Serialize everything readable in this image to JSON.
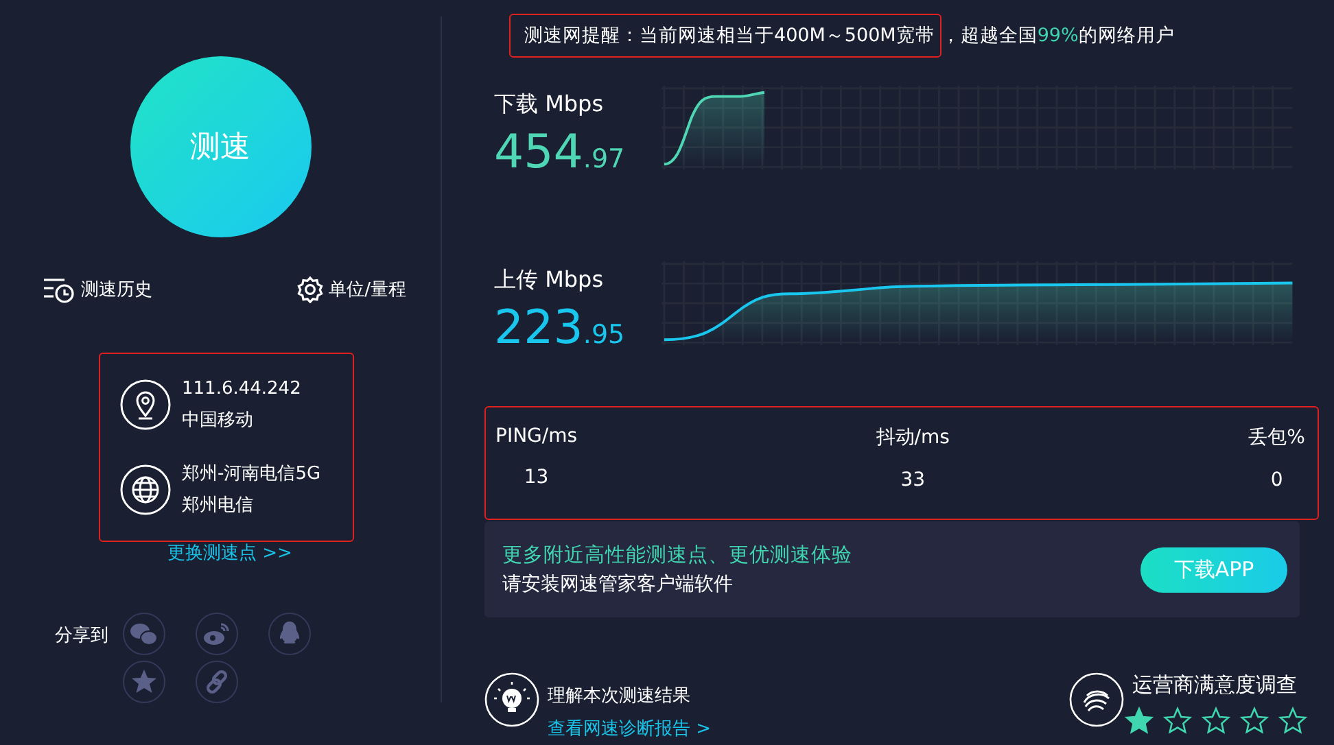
{
  "test_button": {
    "label": "测速"
  },
  "tools": [
    {
      "kind": "history",
      "label": "测速历史"
    },
    {
      "kind": "settings",
      "label": "单位/量程"
    }
  ],
  "connection": {
    "highlighted": true,
    "items": [
      {
        "kind": "location",
        "primary": "111.6.44.242",
        "secondary": "中国移动"
      },
      {
        "kind": "server",
        "primary": "郑州-河南电信5G",
        "secondary": "郑州电信"
      }
    ]
  },
  "change_server_link": "更换测速点 >>",
  "share": {
    "label": "分享到",
    "targets": [
      {
        "kind": "wechat"
      },
      {
        "kind": "weibo"
      },
      {
        "kind": "qq"
      },
      {
        "kind": "qzone"
      },
      {
        "kind": "link"
      }
    ]
  },
  "notice": {
    "highlighted": true,
    "text": "测速网提醒：当前网速相当于400M～500M宽带",
    "suffix_before": "，超越全国",
    "percent": "99%",
    "suffix_after": "的网络用户"
  },
  "download": {
    "label": "下载 Mbps",
    "integer": "454",
    "decimal": ".97"
  },
  "upload": {
    "label": "上传 Mbps",
    "integer": "223",
    "decimal": ".95"
  },
  "stats": {
    "highlighted": true,
    "columns": [
      {
        "label": "PING/ms",
        "value": "13"
      },
      {
        "label": "抖动/ms",
        "value": "33"
      },
      {
        "label": "丢包%",
        "value": "0"
      }
    ]
  },
  "promo": {
    "headline": "更多附近高性能测速点、更优测速体验",
    "text": "请安装网速管家客户端软件",
    "button": "下载APP"
  },
  "report": {
    "title": "理解本次测速结果",
    "link": "查看网速诊断报告 >"
  },
  "survey": {
    "title": "运营商满意度调查",
    "stars": 1
  }
}
